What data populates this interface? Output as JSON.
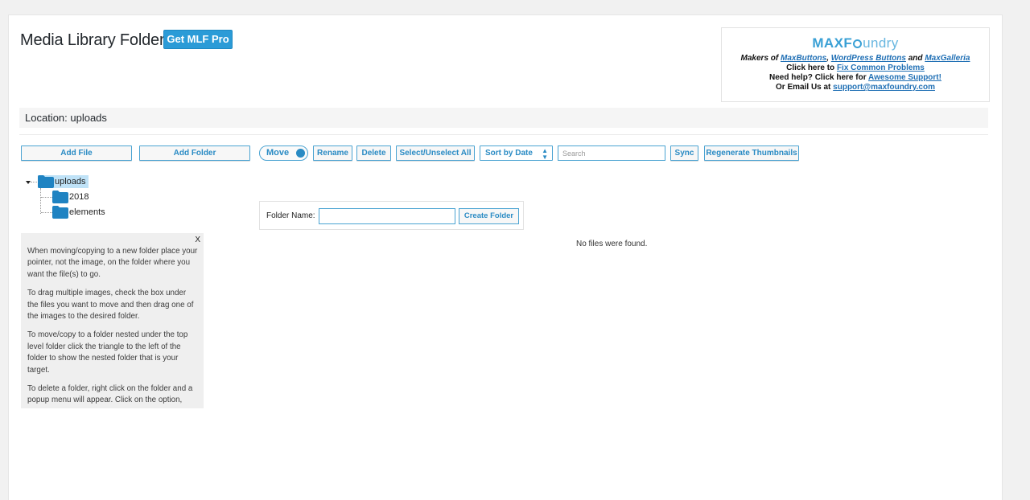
{
  "header": {
    "title": "Media Library Folders",
    "pro_button": "Get MLF Pro"
  },
  "maxfoundry": {
    "brand_bold": "MAXF",
    "brand_rest": "undry",
    "line1_prefix": "Makers of",
    "link_maxbuttons": "MaxButtons",
    "comma1": ",",
    "link_wp_buttons": "WordPress Buttons",
    "and": "and",
    "link_maxgalleria": "MaxGalleria",
    "line2_prefix": "Click here to",
    "link_fix": "Fix Common Problems",
    "line3_prefix": "Need help? Click here for",
    "link_support": "Awesome Support!",
    "line4_prefix": "Or Email Us at",
    "link_email": "support@maxfoundry.com"
  },
  "location": {
    "text": "Location: uploads"
  },
  "toolbar": {
    "add_file": "Add File",
    "add_folder": "Add Folder",
    "move_toggle": "Move",
    "rename": "Rename",
    "delete": "Delete",
    "select_unselect": "Select/Unselect All",
    "sort_selected": "Sort by Date",
    "search_placeholder": "Search",
    "sync": "Sync",
    "regenerate": "Regenerate Thumbnails"
  },
  "tree": {
    "root": "uploads",
    "children": [
      "2018",
      "elements"
    ]
  },
  "help": {
    "close": "X",
    "p1": "When moving/copying to a new folder place your pointer, not the image, on the folder where you want the file(s) to go.",
    "p2": "To drag multiple images, check the box under the files you want to move and then drag one of the images to the desired folder.",
    "p3": "To move/copy to a folder nested under the top level folder click the triangle to the left of the folder to show the nested folder that is your target.",
    "p4": "To delete a folder, right click on the folder and a popup menu will appear. Click on the option,"
  },
  "create_folder": {
    "label": "Folder Name:",
    "value": "",
    "button": "Create Folder"
  },
  "files": {
    "empty_message": "No files were found."
  },
  "colors": {
    "accent": "#2b9bd7",
    "folder": "#1f83c2",
    "selected": "#bfe2f7"
  }
}
